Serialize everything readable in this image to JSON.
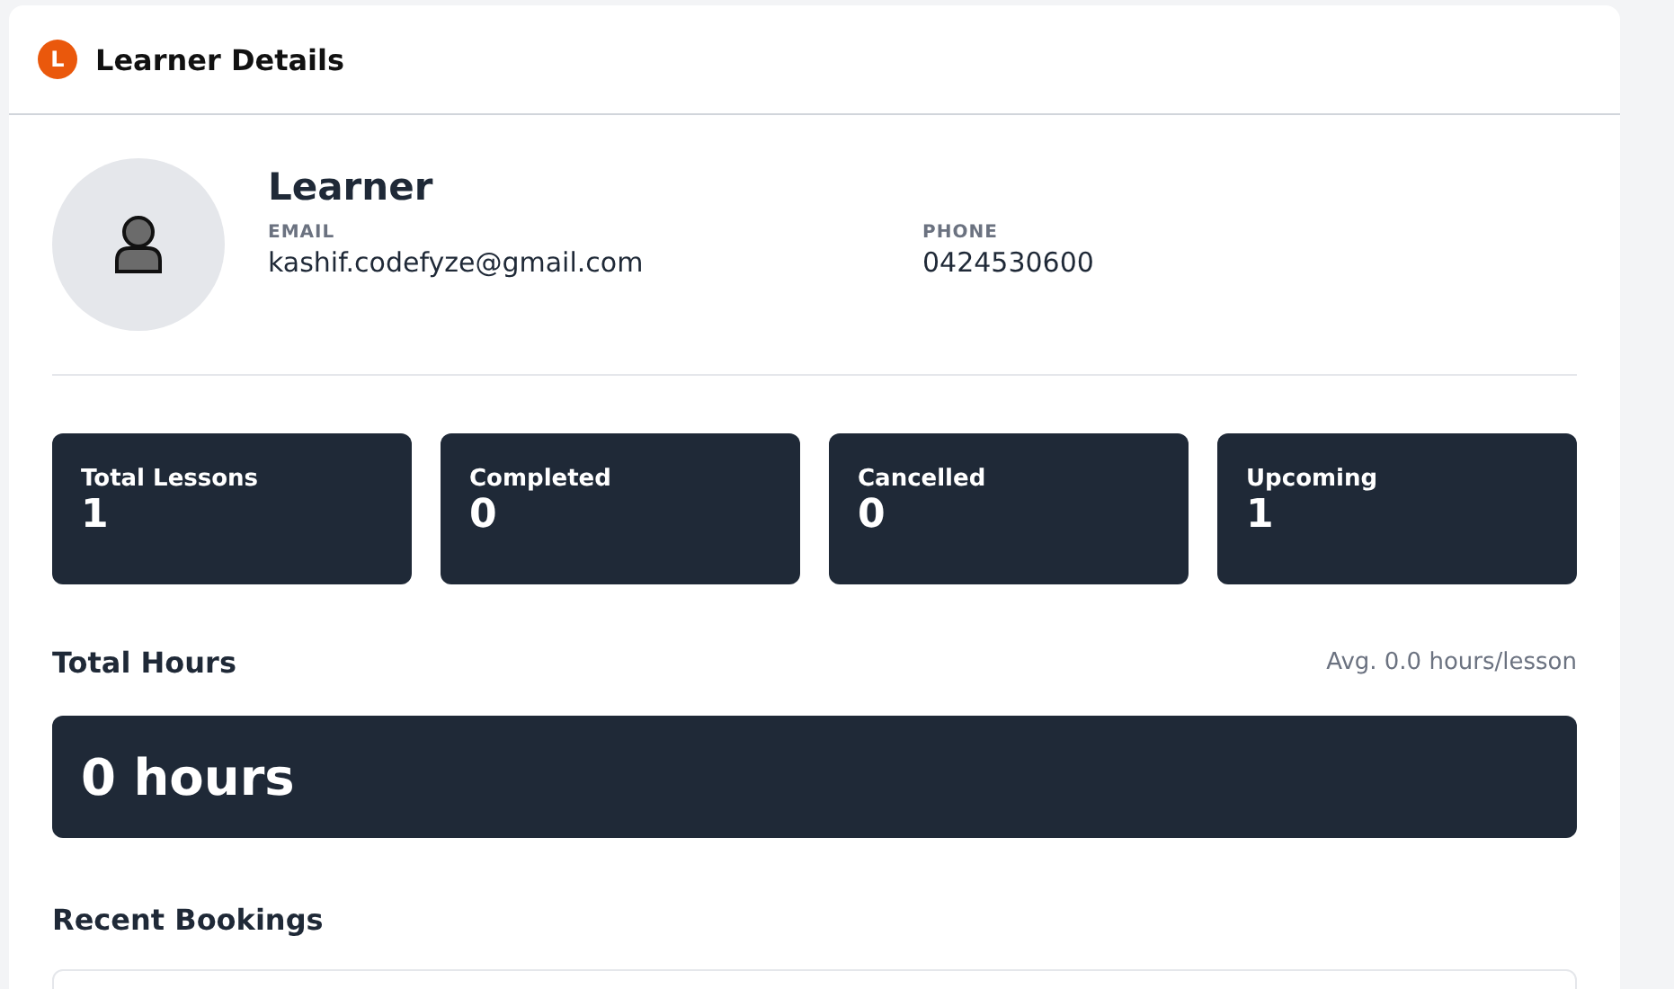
{
  "header": {
    "badge": "L",
    "title": "Learner Details"
  },
  "profile": {
    "name": "Learner",
    "fields": [
      {
        "label": "EMAIL",
        "value": "kashif.codefyze@gmail.com"
      },
      {
        "label": "PHONE",
        "value": "0424530600"
      }
    ]
  },
  "stats": [
    {
      "label": "Total Lessons",
      "value": "1"
    },
    {
      "label": "Completed",
      "value": "0"
    },
    {
      "label": "Cancelled",
      "value": "0"
    },
    {
      "label": "Upcoming",
      "value": "1"
    }
  ],
  "hours": {
    "title": "Total Hours",
    "average": "Avg. 0.0 hours/lesson",
    "total": "0 hours"
  },
  "recent": {
    "title": "Recent Bookings"
  }
}
